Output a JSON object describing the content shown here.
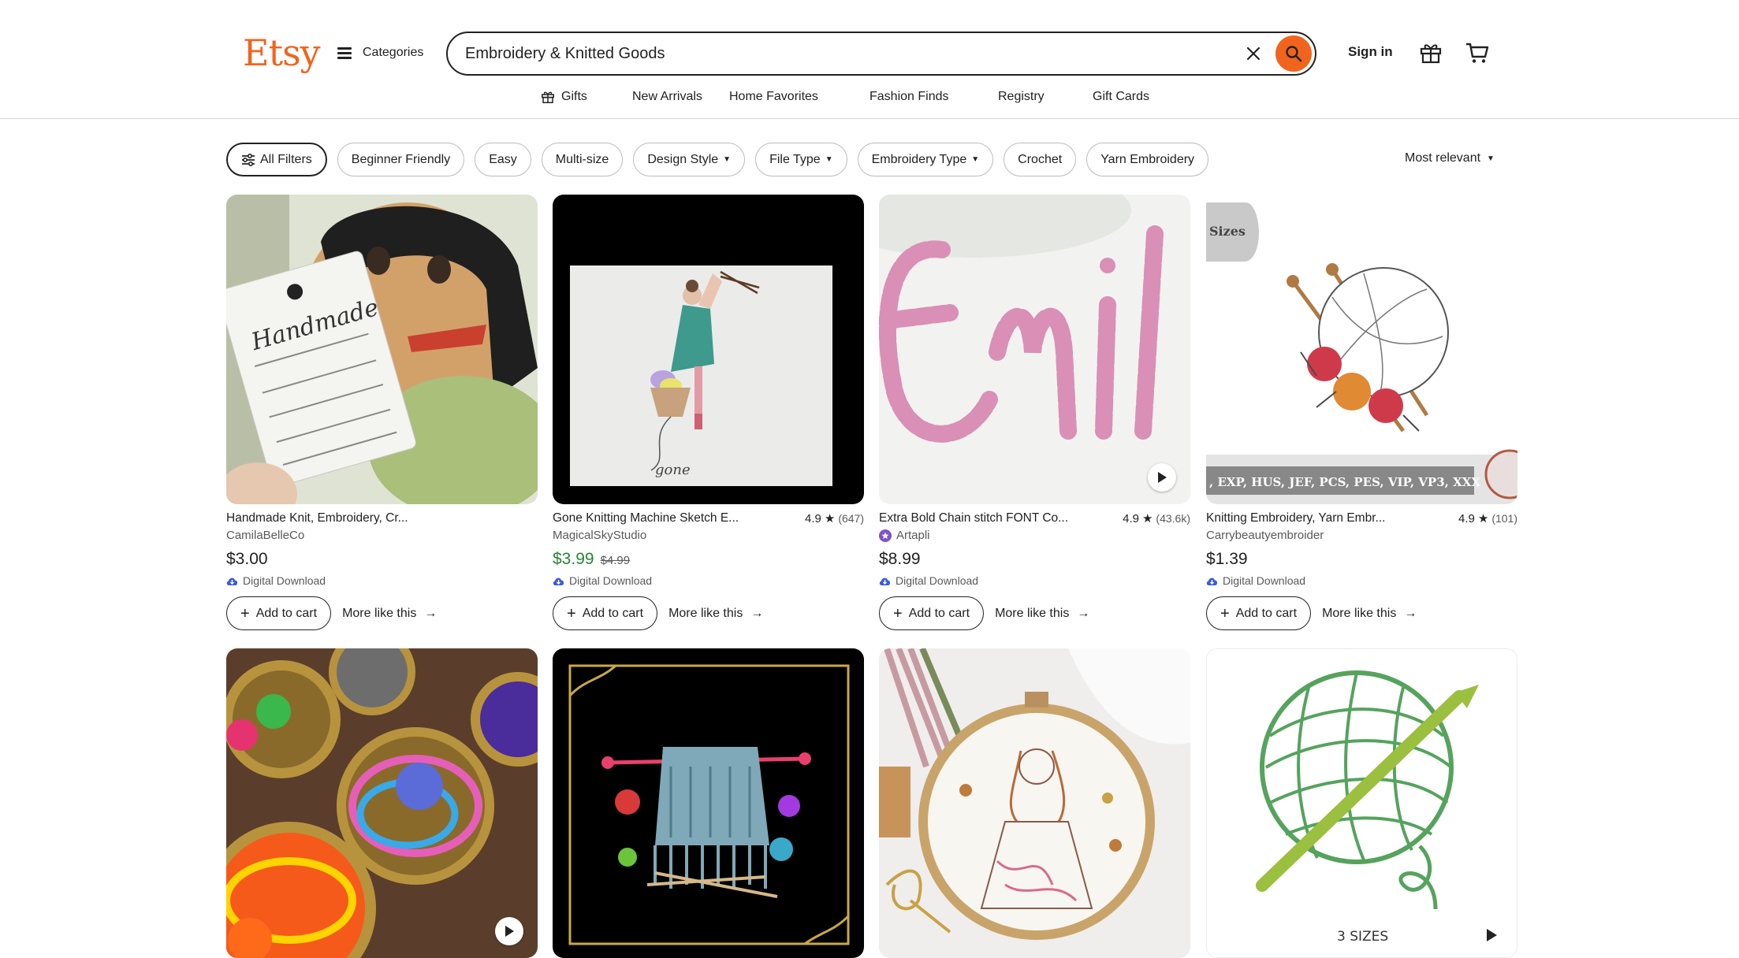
{
  "header": {
    "logo": "Etsy",
    "categories_label": "Categories",
    "search_value": "Embroidery & Knitted Goods",
    "signin_label": "Sign in"
  },
  "nav": [
    "Gifts",
    "New Arrivals",
    "Home Favorites",
    "Fashion Finds",
    "Registry",
    "Gift Cards"
  ],
  "filters": {
    "all_filters": "All Filters",
    "pills": [
      "Beginner Friendly",
      "Easy",
      "Multi-size",
      "Design Style",
      "File Type",
      "Embroidery Type",
      "Crochet",
      "Yarn Embroidery"
    ],
    "dropdown_pills": [
      "Design Style",
      "File Type",
      "Embroidery Type"
    ],
    "sort_label": "Most relevant"
  },
  "colors": {
    "brand": "#f1641e",
    "sale": "#258635"
  },
  "listings": [
    {
      "title": "Handmade Knit, Embroidery, Cr...",
      "shop": "CamilaBelleCo",
      "price": "$3.00",
      "type": "Digital Download",
      "add": "Add to cart",
      "more": "More like this"
    },
    {
      "title": "Gone Knitting Machine Sketch E...",
      "rating": "4.9",
      "count": "(647)",
      "shop": "MagicalSkyStudio",
      "price": "$3.99",
      "old_price": "$4.99",
      "type": "Digital Download",
      "add": "Add to cart",
      "more": "More like this"
    },
    {
      "title": "Extra Bold Chain stitch FONT Co...",
      "rating": "4.9",
      "count": "(43.6k)",
      "shop": "Artapli",
      "price": "$8.99",
      "type": "Digital Download",
      "add": "Add to cart",
      "more": "More like this"
    },
    {
      "title": "Knitting Embroidery, Yarn Embr...",
      "rating": "4.9",
      "count": "(101)",
      "shop": "Carrybeautyembroider",
      "price": "$1.39",
      "type": "Digital Download",
      "add": "Add to cart",
      "more": "More like this"
    }
  ],
  "image_text": {
    "tag_handmade": "Handmade",
    "sizes_badge": "Sizes",
    "formats_banner": ", EXP, HUS, JEF, PCS, PES, VIP, VP3, XXX",
    "three_sizes": "3 SIZES",
    "gone": "gone"
  }
}
